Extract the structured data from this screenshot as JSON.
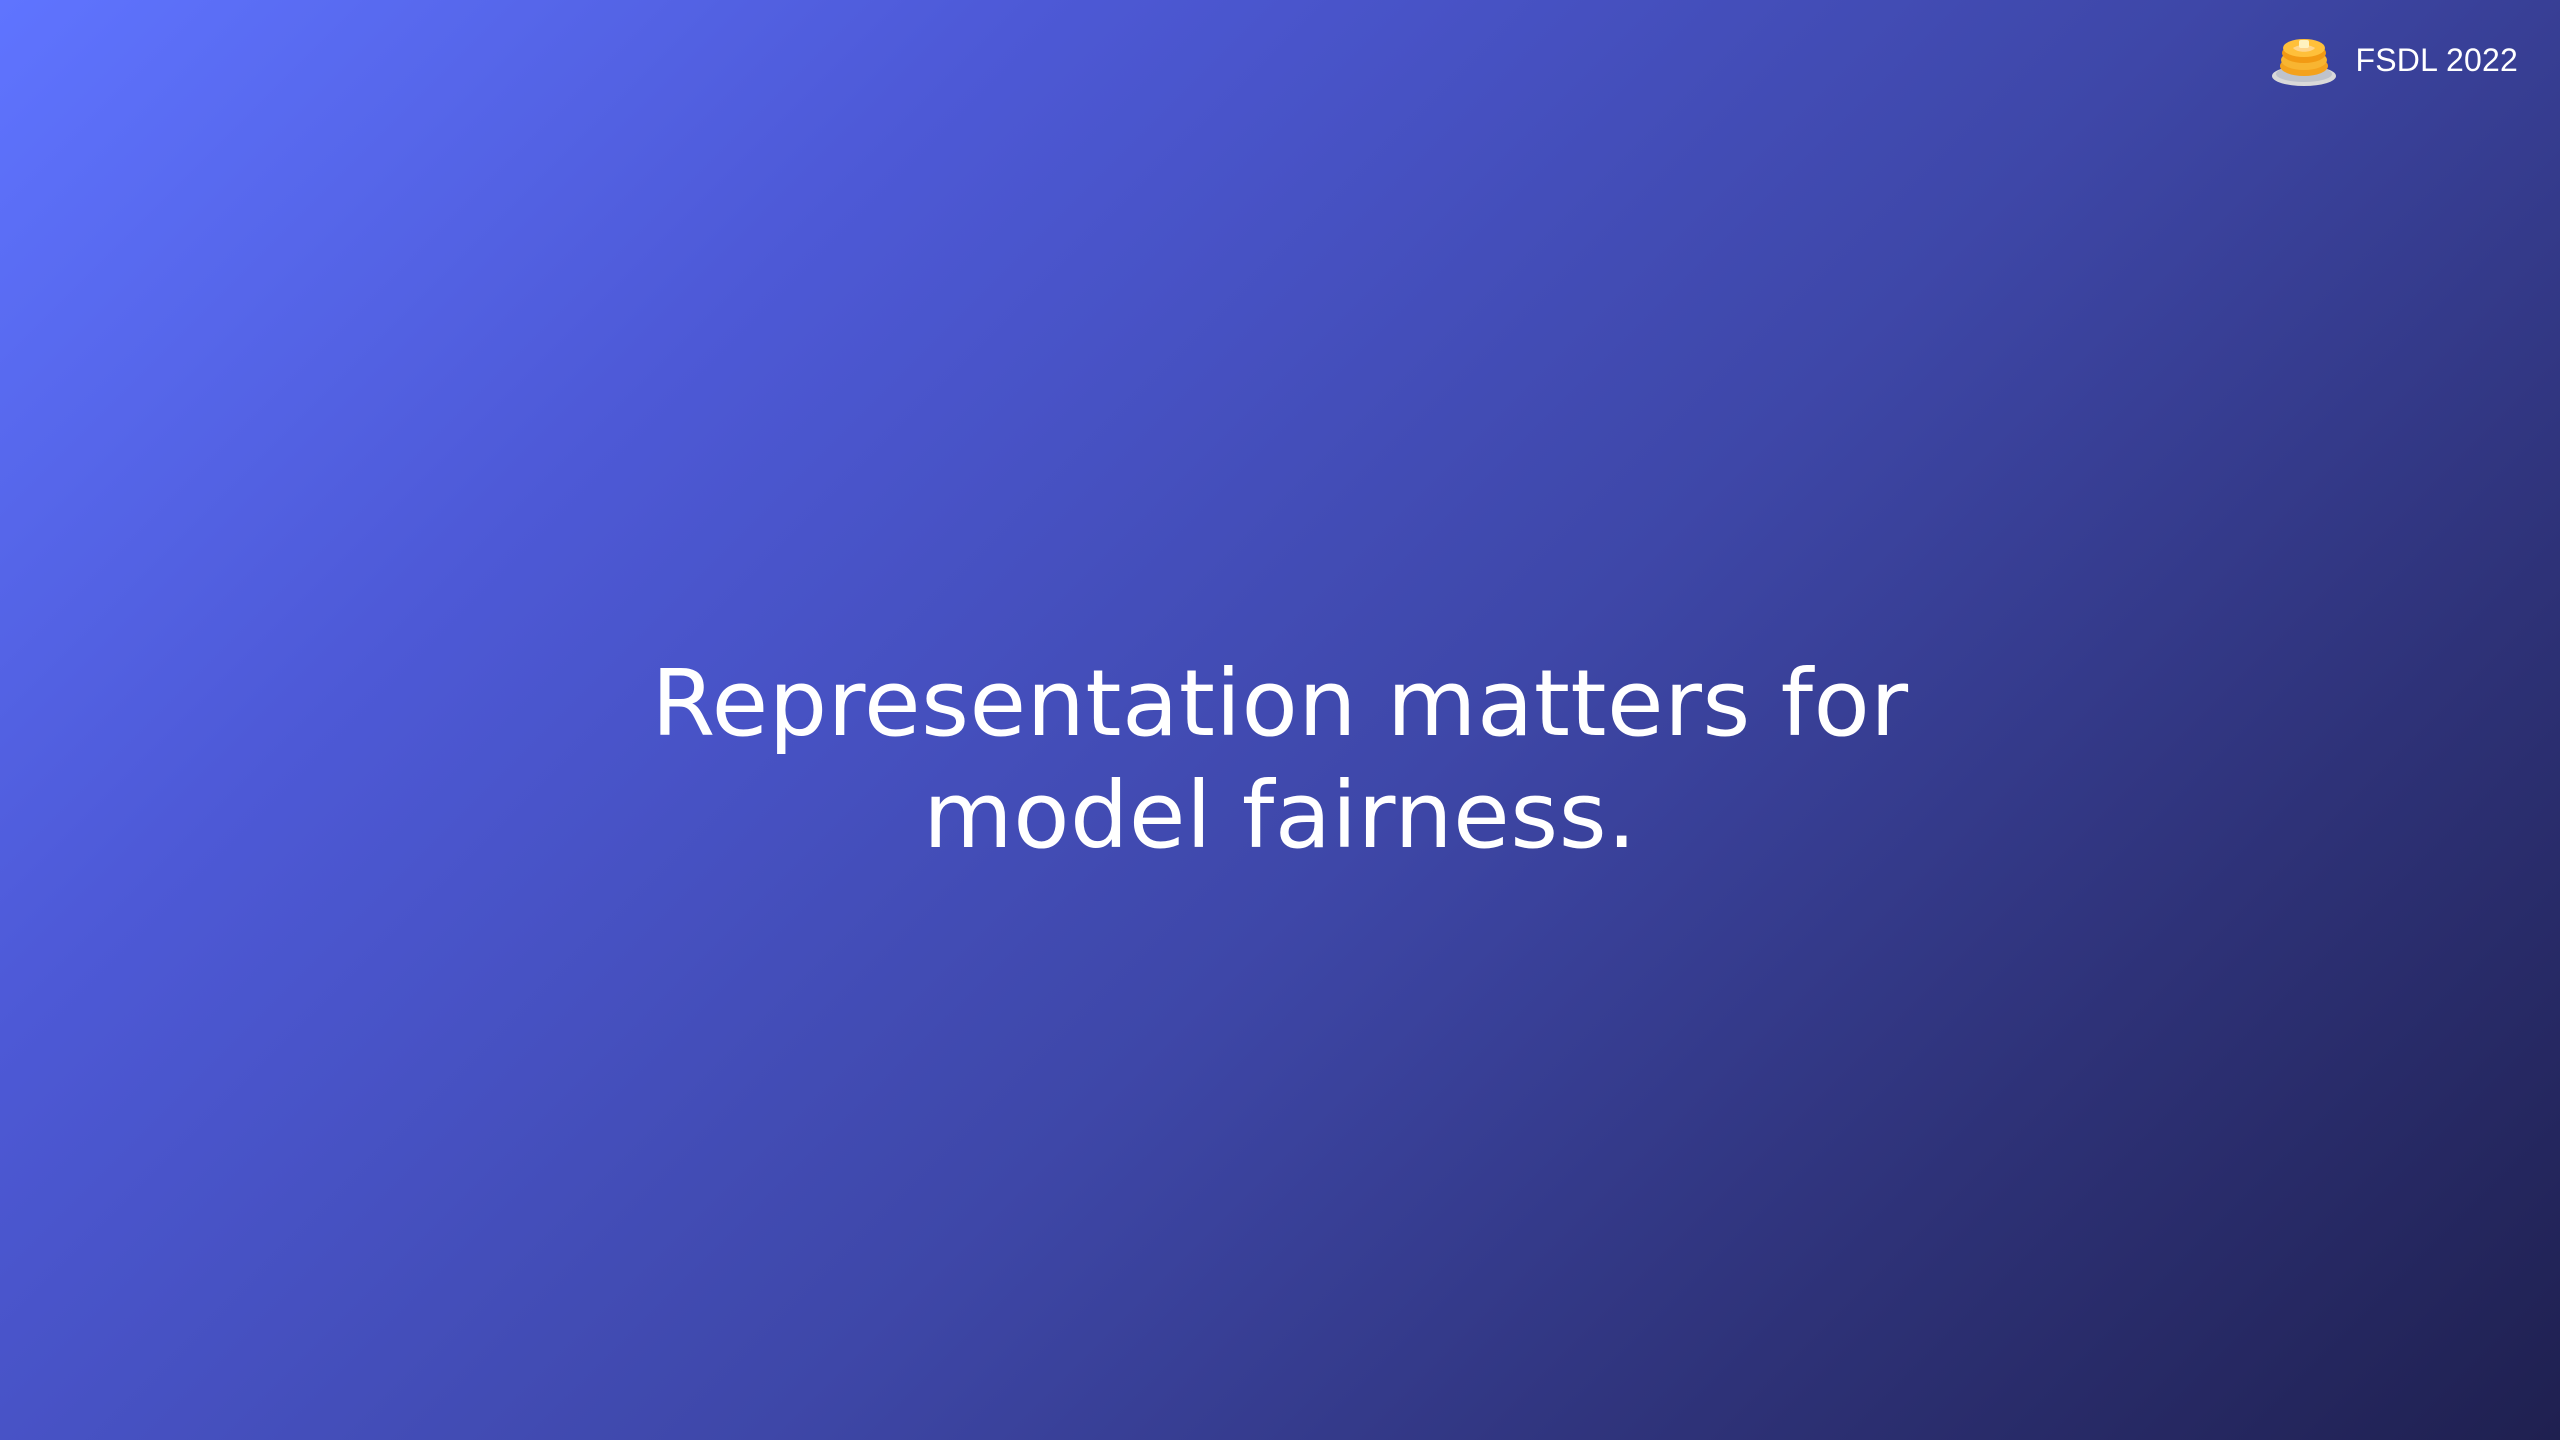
{
  "slide": {
    "background_gradient": [
      "#5f74ff",
      "#4d59d6",
      "#3e47a8",
      "#2e3278",
      "#1f2050"
    ],
    "brand": {
      "icon": "pancakes-icon",
      "label": "FSDL 2022"
    },
    "title_lines": [
      "Representation matters for",
      "model fairness."
    ]
  }
}
